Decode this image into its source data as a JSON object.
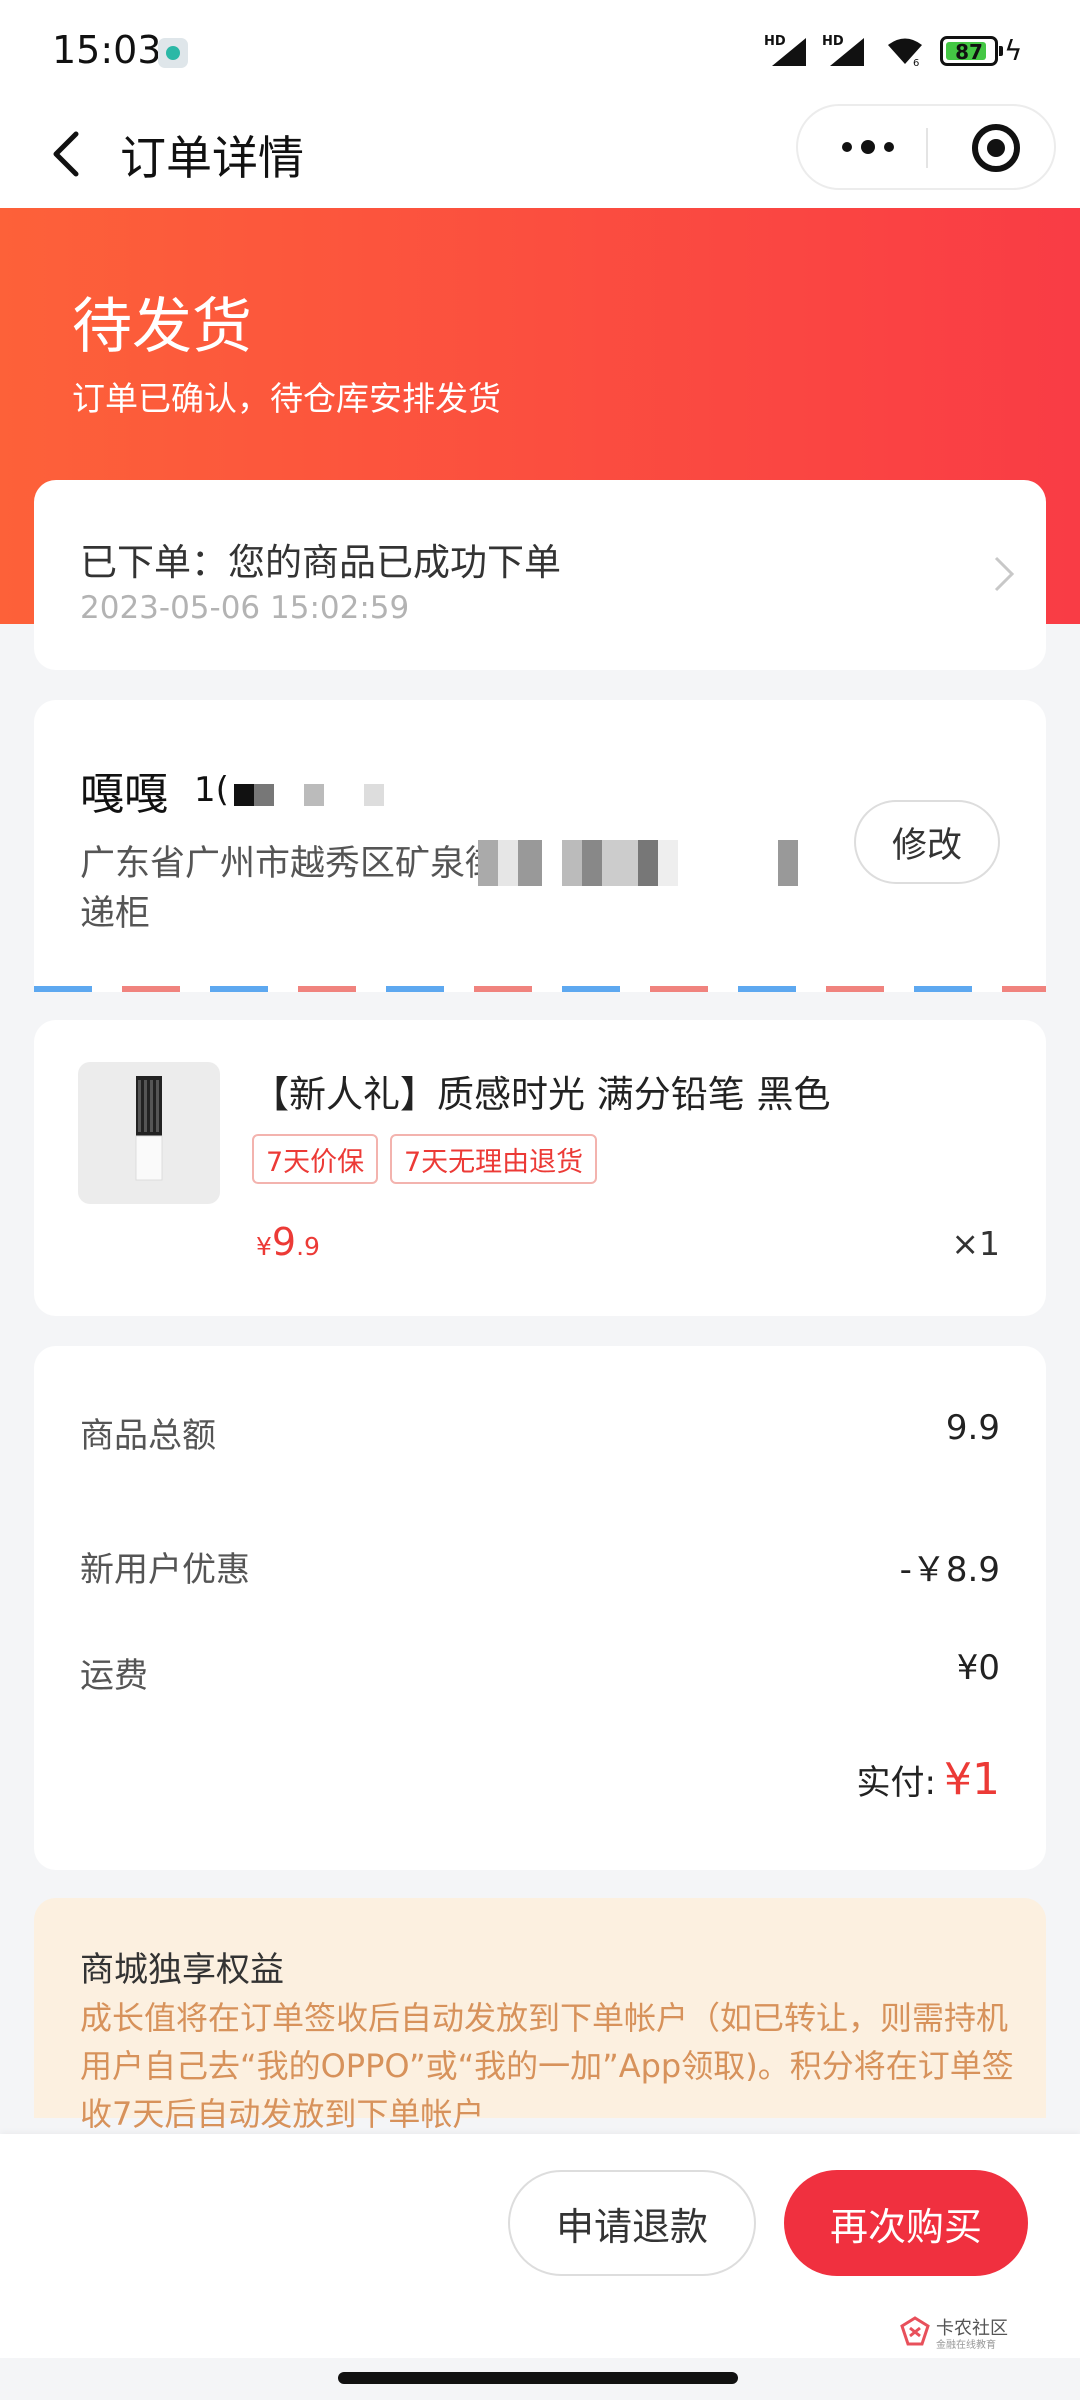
{
  "status_bar": {
    "time": "15:03",
    "battery": "87",
    "battery_level": 0.87,
    "signal_label": "HD"
  },
  "nav": {
    "title": "订单详情"
  },
  "header": {
    "title": "待发货",
    "subtitle": "订单已确认，待仓库安排发货",
    "gradient_start": "#fd6139",
    "gradient_end": "#f93c45"
  },
  "progress": {
    "text": "已下单：您的商品已成功下单",
    "time": "2023-05-06 15:02:59"
  },
  "address": {
    "name": "嘎嘎",
    "phone_visible": "1(",
    "line1": "广东省广州市越秀区矿泉街",
    "line2": "递柜",
    "edit_label": "修改"
  },
  "product": {
    "name": "【新人礼】质感时光 满分铅笔 黑色",
    "tags": [
      "7天价保",
      "7天无理由退货"
    ],
    "price_currency": "¥",
    "price_int": "9",
    "price_dec": ".9",
    "quantity": "×1"
  },
  "summary": {
    "rows": [
      {
        "label": "商品总额",
        "value": "9.9"
      },
      {
        "label": "新用户优惠",
        "value": "-￥8.9"
      },
      {
        "label": "运费",
        "value": "¥0"
      }
    ],
    "paid_label": "实付:",
    "paid_value": "¥1"
  },
  "benefit": {
    "title": "商城独享权益",
    "text": "成长值将在订单签收后自动发放到下单帐户（如已转让，则需持机用户自己去“我的OPPO”或“我的一加”App领取)。积分将在订单签收7天后自动发放到下单帐户"
  },
  "actions": {
    "refund_label": "申请退款",
    "rebuy_label": "再次购买",
    "accent": "#f0303f"
  },
  "watermark": {
    "title": "卡农社区",
    "subtitle": "金融在线教育"
  }
}
